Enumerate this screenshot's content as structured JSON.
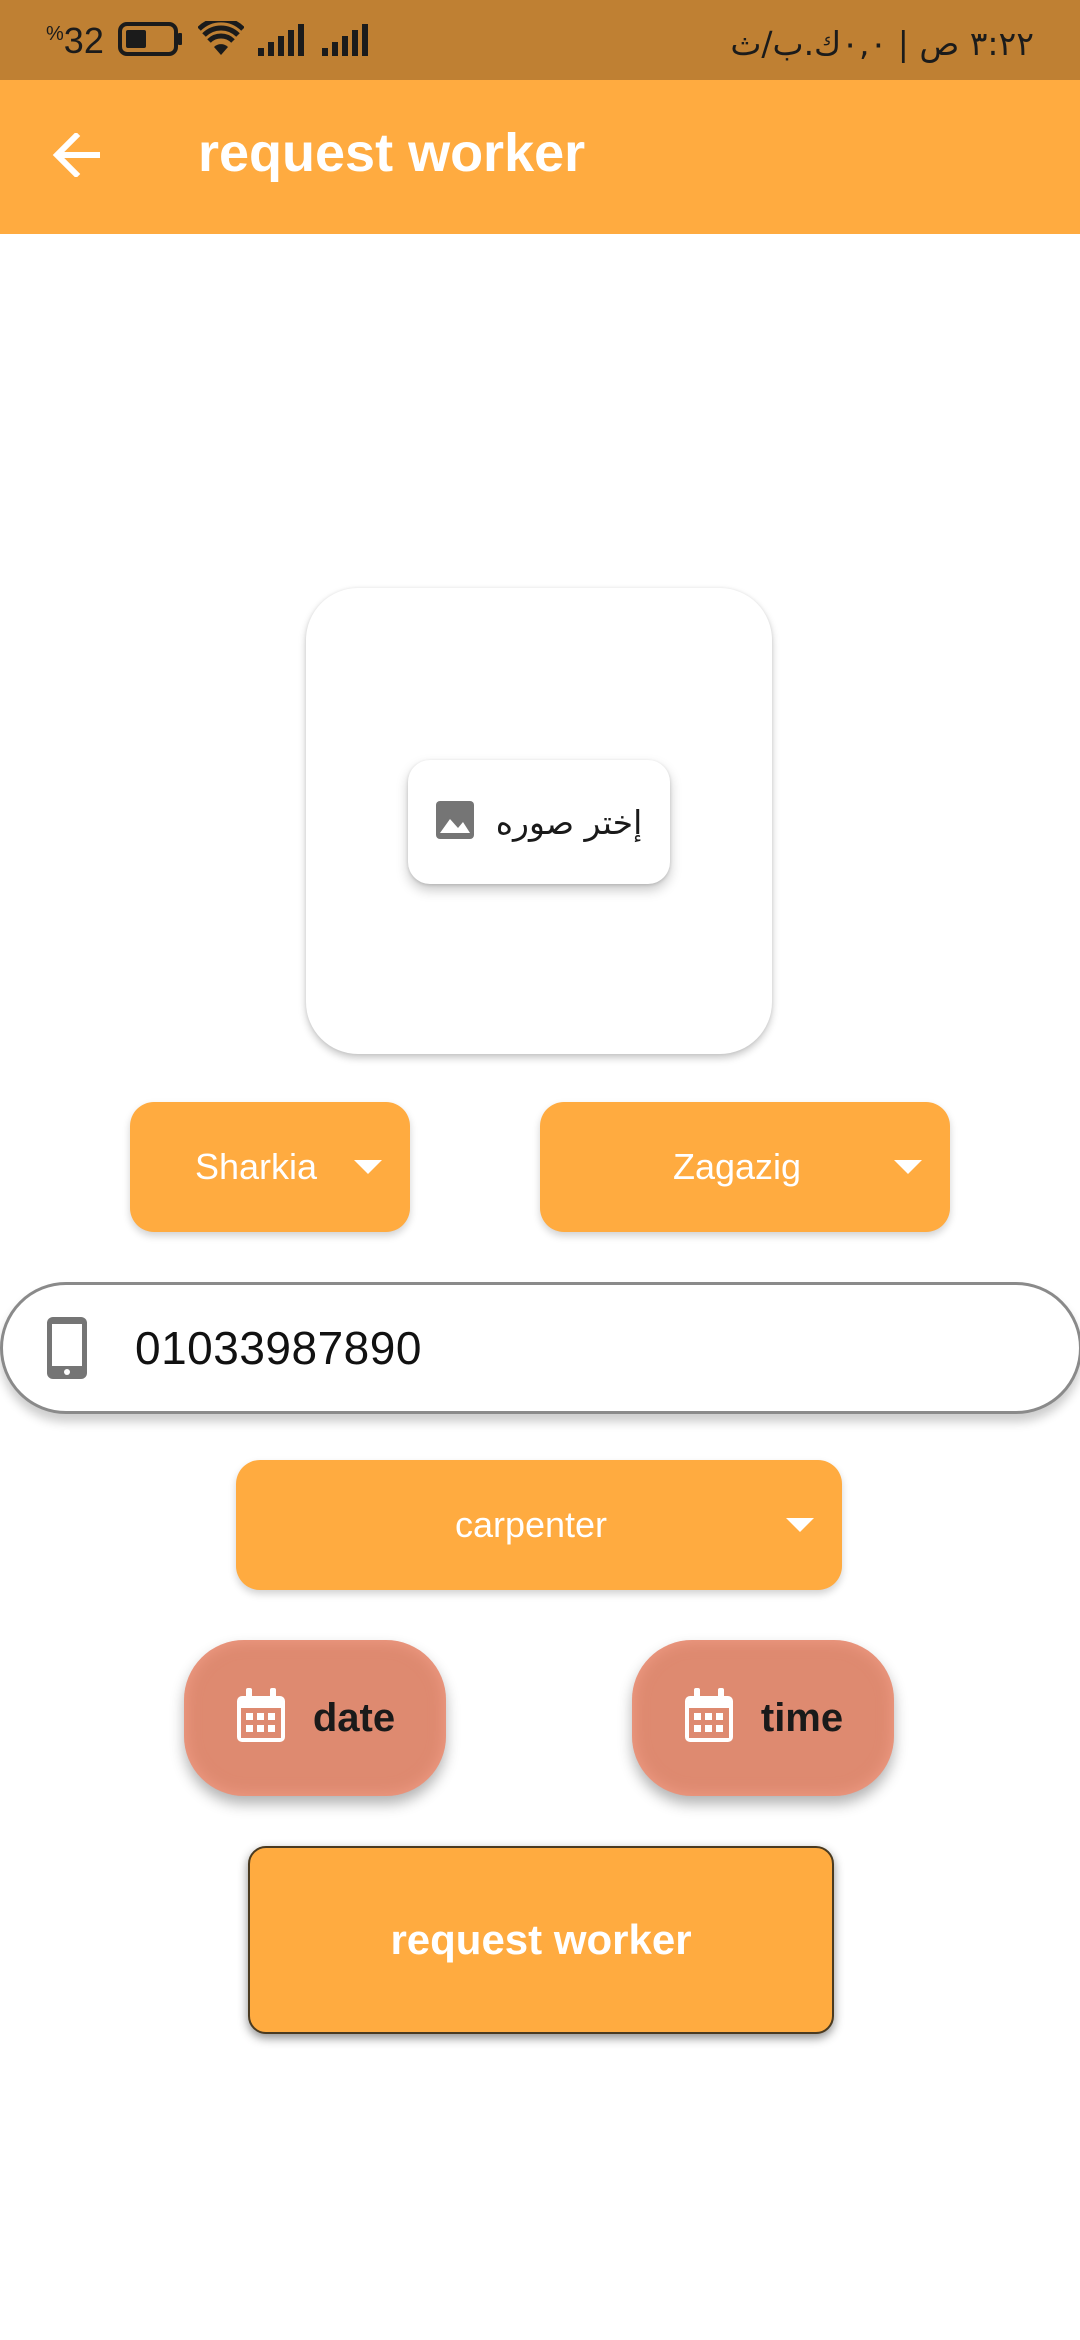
{
  "status_bar": {
    "battery_level": "32",
    "battery_symbol": "%",
    "right_text": "٣:٢٢ ص | ٠,٠ك.ب/ث",
    "icons": [
      "battery-icon",
      "wifi-icon",
      "signal-icon",
      "signal-icon"
    ]
  },
  "app_bar": {
    "title": "request worker",
    "back_icon": "arrow-back-icon",
    "background": "#ffab40"
  },
  "image_picker": {
    "button_label": "إختر صوره",
    "icon": "image-icon"
  },
  "dropdowns": {
    "governorate": {
      "value": "Sharkia"
    },
    "city": {
      "value": "Zagazig"
    },
    "profession": {
      "value": "carpenter"
    }
  },
  "phone": {
    "value": "01033987890",
    "icon": "phone-icon"
  },
  "date_button": {
    "label": "date",
    "icon": "calendar-icon"
  },
  "time_button": {
    "label": "time",
    "icon": "calendar-icon"
  },
  "submit": {
    "label": "request worker"
  },
  "colors": {
    "accent": "#ffab40",
    "status_bar": "#bf8033",
    "pill": "#de8a70"
  }
}
